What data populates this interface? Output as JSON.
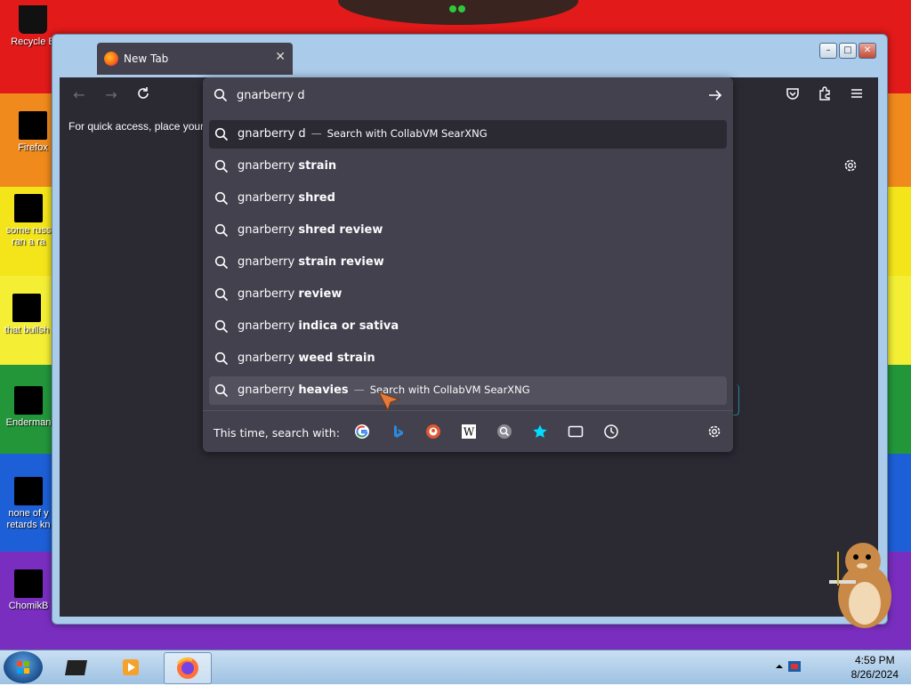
{
  "desktop": {
    "icons": [
      {
        "label": "Recycle B",
        "top": 0
      },
      {
        "label": "Firefox"
      },
      {
        "label": "some russ"
      },
      {
        "label": "ran a ra"
      },
      {
        "label": "that bullsh"
      },
      {
        "label": "Enderman"
      },
      {
        "label": "none of y"
      },
      {
        "label": "retards kn"
      },
      {
        "label": "ChomikB"
      }
    ]
  },
  "window": {
    "tab_title": "New Tab",
    "tab_close": "✕",
    "min_label": "–",
    "max_label": "□",
    "close_label": "✕"
  },
  "bookmarks": {
    "text": "For quick access, place your b"
  },
  "urlbar": {
    "value": "gnarberry d",
    "suggestions": [
      {
        "prefix": "gnarberry d",
        "bold": "",
        "action": "Search with CollabVM SearXNG",
        "state": "selected"
      },
      {
        "prefix": "gnarberry ",
        "bold": "strain",
        "action": "",
        "state": ""
      },
      {
        "prefix": "gnarberry ",
        "bold": "shred",
        "action": "",
        "state": ""
      },
      {
        "prefix": "gnarberry ",
        "bold": "shred review",
        "action": "",
        "state": ""
      },
      {
        "prefix": "gnarberry ",
        "bold": "strain review",
        "action": "",
        "state": ""
      },
      {
        "prefix": "gnarberry ",
        "bold": "review",
        "action": "",
        "state": ""
      },
      {
        "prefix": "gnarberry ",
        "bold": "indica or sativa",
        "action": "",
        "state": ""
      },
      {
        "prefix": "gnarberry ",
        "bold": "weed strain",
        "action": "",
        "state": ""
      },
      {
        "prefix": "gnarberry ",
        "bold": "heavies",
        "action": "Search with CollabVM SearXNG",
        "state": "hover"
      }
    ],
    "separator": "—",
    "oneoff_label": "This time, search with:",
    "engines": [
      "google-icon",
      "bing-icon",
      "duckduckgo-icon",
      "wikipedia-icon",
      "searxng-icon",
      "bookmarks-icon",
      "tabs-icon",
      "history-icon"
    ]
  },
  "taskbar": {
    "time": "4:59 PM",
    "date": "8/26/2024"
  },
  "colors": {
    "panel": "#42414d",
    "background": "#2b2a33",
    "text": "#fbfbfe"
  }
}
